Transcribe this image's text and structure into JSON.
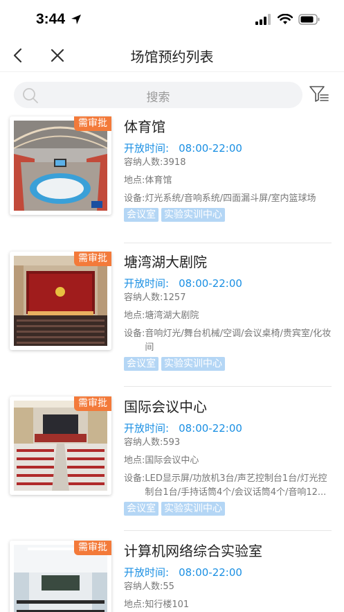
{
  "status": {
    "time": "3:44"
  },
  "nav": {
    "title": "场馆预约列表"
  },
  "search": {
    "placeholder": "搜索"
  },
  "labels": {
    "hours": "开放时间:",
    "capacity": "容纳人数:",
    "location": "地点:",
    "equipment": "设备:"
  },
  "venues": [
    {
      "name": "体育馆",
      "badge": "需审批",
      "hours": "08:00-22:00",
      "capacity": "3918",
      "location": "体育馆",
      "equipment": "灯光系统/音响系统/四面漏斗屏/室内篮球场",
      "tags": [
        "会议室",
        "实验实训中心"
      ]
    },
    {
      "name": "塘湾湖大剧院",
      "badge": "需审批",
      "hours": "08:00-22:00",
      "capacity": "1257",
      "location": "塘湾湖大剧院",
      "equipment": "音响灯光/舞台机械/空调/会议桌椅/贵宾室/化妆间",
      "tags": [
        "会议室",
        "实验实训中心"
      ]
    },
    {
      "name": "国际会议中心",
      "badge": "需审批",
      "hours": "08:00-22:00",
      "capacity": "593",
      "location": "国际会议中心",
      "equipment": "LED显示屏/功放机3台/声艺控制台1台/灯光控制台1台/手持话筒4个/会议话筒4个/音响12...",
      "tags": [
        "会议室",
        "实验实训中心"
      ]
    },
    {
      "name": "计算机网络综合实验室",
      "badge": "需审批",
      "hours": "08:00-22:00",
      "capacity": "55",
      "location": "知行楼101"
    }
  ]
}
